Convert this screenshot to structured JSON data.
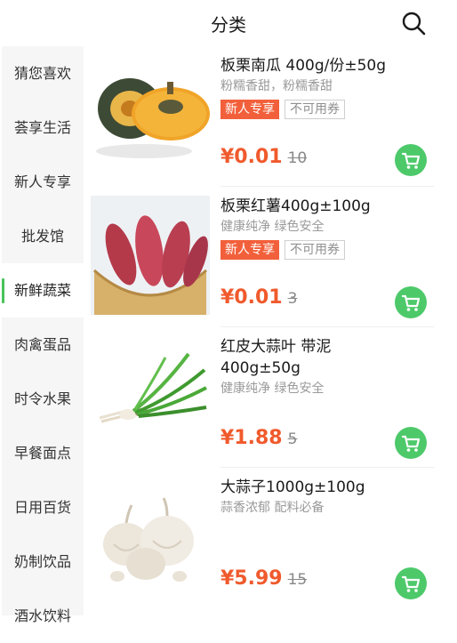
{
  "header": {
    "title": "分类"
  },
  "sidebar": {
    "items": [
      {
        "label": "猜您喜欢"
      },
      {
        "label": "荟享生活"
      },
      {
        "label": "新人专享"
      },
      {
        "label": "批发馆"
      },
      {
        "label": "新鲜蔬菜",
        "active": true
      },
      {
        "label": "肉禽蛋品"
      },
      {
        "label": "时令水果"
      },
      {
        "label": "早餐面点"
      },
      {
        "label": "日用百货"
      },
      {
        "label": "奶制饮品"
      },
      {
        "label": "酒水饮料"
      }
    ]
  },
  "products": [
    {
      "name": "板栗南瓜 400g/份±50g",
      "desc": "粉糯香甜，粉糯香甜",
      "tags": [
        "新人专享",
        "不可用券"
      ],
      "price": "¥0.01",
      "old_price": "10",
      "image": "pumpkin-image"
    },
    {
      "name": "板栗红薯400g±100g",
      "desc": "健康纯净 绿色安全",
      "tags": [
        "新人专享",
        "不可用券"
      ],
      "price": "¥0.01",
      "old_price": "3",
      "image": "sweet-potato-image"
    },
    {
      "name_line1": "红皮大蒜叶 带泥",
      "name_line2": "400g±50g",
      "desc": "健康纯净 绿色安全",
      "price": "¥1.88",
      "old_price": "5",
      "image": "garlic-leaf-image"
    },
    {
      "name": "大蒜子1000g±100g",
      "desc": "蒜香浓郁 配料必备",
      "price": "¥5.99",
      "old_price": "15",
      "image": "garlic-bulb-image"
    }
  ],
  "colors": {
    "accent": "#4dc96a",
    "price": "#f05a2c",
    "tag": "#f2603b"
  }
}
